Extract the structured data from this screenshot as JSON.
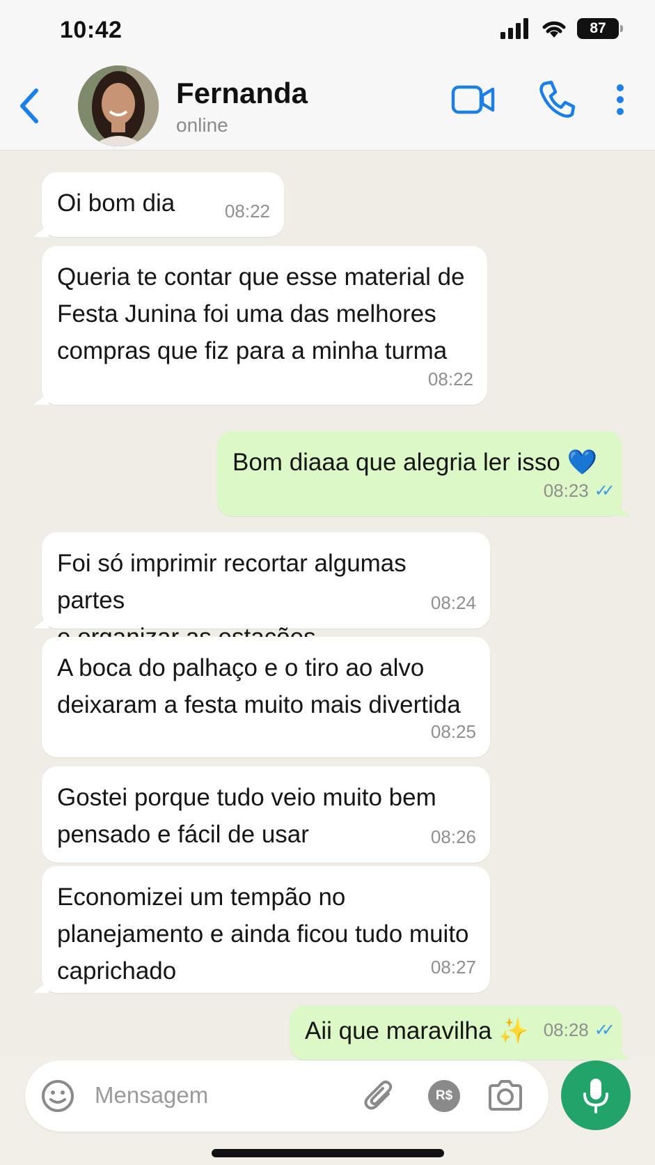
{
  "status_bar": {
    "time": "10:42",
    "battery": "87",
    "icons": [
      "signal-icon",
      "wifi-icon",
      "battery-icon"
    ]
  },
  "header": {
    "contact_name": "Fernanda",
    "contact_status": "online",
    "icons": [
      "back-icon",
      "video-call-icon",
      "voice-call-icon",
      "more-icon"
    ],
    "accent_color": "#1a7fe8"
  },
  "messages": [
    {
      "direction": "in",
      "text": "Oi bom dia",
      "time": "08:22"
    },
    {
      "direction": "in",
      "text": "Queria te contar que esse material de\nFesta Junina foi uma das melhores\ncompras que fiz para a minha turma",
      "time": "08:22"
    },
    {
      "direction": "out",
      "text": "Bom diaaa que alegria ler isso 💙",
      "time": "08:23",
      "read": true
    },
    {
      "direction": "in",
      "text": "Foi só imprimir recortar algumas partes\ne organizar as estações",
      "time": "08:24"
    },
    {
      "direction": "in",
      "text": "A boca do palhaço e o tiro ao alvo\ndeixaram a festa muito mais divertida",
      "time": "08:25"
    },
    {
      "direction": "in",
      "text": "Gostei porque tudo veio muito bem\npensado e fácil de usar",
      "time": "08:26"
    },
    {
      "direction": "in",
      "text": "Economizei um tempão no\nplanejamento e ainda ficou tudo muito\ncaprichado",
      "time": "08:27"
    },
    {
      "direction": "out",
      "text": "Aii que maravilha ✨",
      "time": "08:28",
      "read": true
    }
  ],
  "composer": {
    "placeholder": "Mensagem",
    "payment_label": "R$",
    "icons": [
      "emoji-icon",
      "attach-icon",
      "payment-icon",
      "camera-icon",
      "mic-icon"
    ]
  },
  "colors": {
    "outgoing_bubble": "#dbf8c6",
    "incoming_bubble": "#ffffff",
    "mic_button": "#21a36a",
    "read_ticks": "#3a9be8"
  }
}
